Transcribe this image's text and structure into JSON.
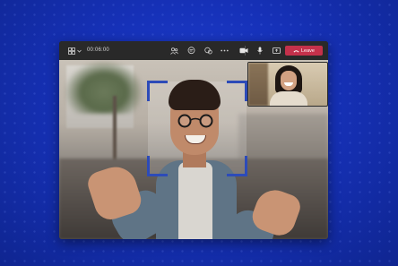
{
  "toolbar": {
    "timer": "00:06:00",
    "leave_label": "Leave",
    "icons": [
      "grid-layout-icon",
      "chevron-down-icon",
      "participants-icon",
      "chat-icon",
      "reactions-icon",
      "more-options-icon",
      "microphone-icon",
      "camera-icon",
      "share-screen-icon",
      "phone-hangup-icon"
    ],
    "colors": {
      "toolbar_bg": "#292929",
      "leave_bg": "#c4314b",
      "frame_accent": "#2d4bb8",
      "backdrop": "#1631b8"
    }
  },
  "stage": {
    "main_participant": "video-feed",
    "pip_participant": "video-feed"
  }
}
